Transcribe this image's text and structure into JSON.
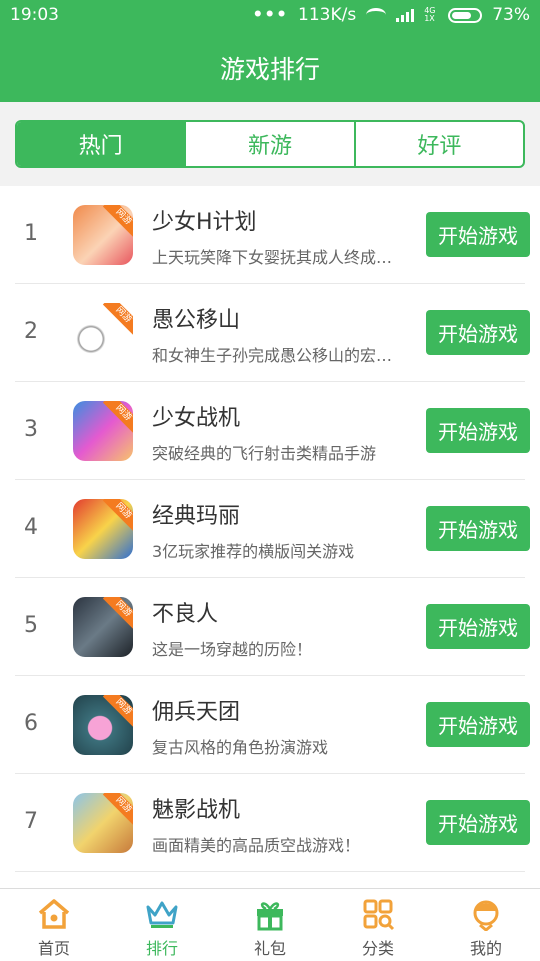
{
  "status_bar": {
    "time": "19:03",
    "dots": "•••",
    "speed": "113K/s",
    "network": "4G 1X",
    "battery_percent": "73%",
    "battery_level": 0.73
  },
  "header": {
    "title": "游戏排行"
  },
  "tabs": [
    {
      "label": "热门",
      "active": true
    },
    {
      "label": "新游",
      "active": false
    },
    {
      "label": "好评",
      "active": false
    }
  ],
  "badge_text": "网游",
  "play_label": "开始游戏",
  "games": [
    {
      "rank": "1",
      "name": "少女H计划",
      "desc": "上天玩笑降下女婴抚其成人终成…"
    },
    {
      "rank": "2",
      "name": "愚公移山",
      "desc": "和女神生子孙完成愚公移山的宏…"
    },
    {
      "rank": "3",
      "name": "少女战机",
      "desc": "突破经典的飞行射击类精品手游"
    },
    {
      "rank": "4",
      "name": "经典玛丽",
      "desc": "3亿玩家推荐的横版闯关游戏"
    },
    {
      "rank": "5",
      "name": "不良人",
      "desc": "这是一场穿越的历险！"
    },
    {
      "rank": "6",
      "name": "佣兵天团",
      "desc": "复古风格的角色扮演游戏"
    },
    {
      "rank": "7",
      "name": "魅影战机",
      "desc": "画面精美的高品质空战游戏！"
    }
  ],
  "bottom_nav": [
    {
      "label": "首页",
      "icon": "home-icon",
      "active": false
    },
    {
      "label": "排行",
      "icon": "crown-icon",
      "active": true
    },
    {
      "label": "礼包",
      "icon": "gift-icon",
      "active": false
    },
    {
      "label": "分类",
      "icon": "category-icon",
      "active": false
    },
    {
      "label": "我的",
      "icon": "profile-icon",
      "active": false
    }
  ],
  "colors": {
    "primary": "#3db85c",
    "accent_orange": "#f47b20"
  }
}
